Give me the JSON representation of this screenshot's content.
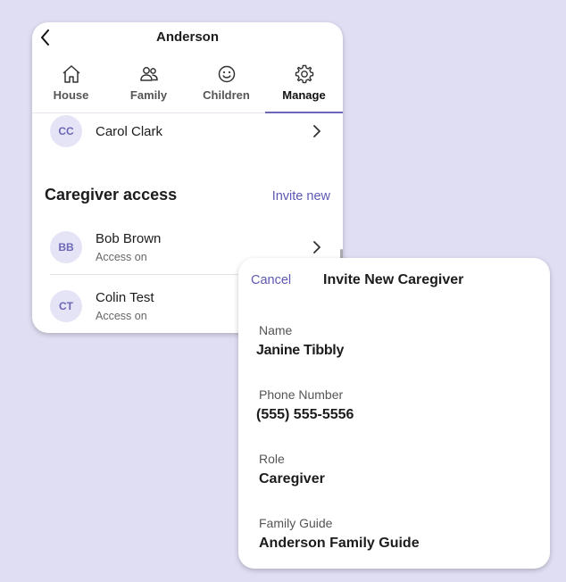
{
  "main": {
    "title": "Anderson",
    "tabs": [
      {
        "label": "House",
        "icon": "house-icon"
      },
      {
        "label": "Family",
        "icon": "family-icon"
      },
      {
        "label": "Children",
        "icon": "smiley-icon"
      },
      {
        "label": "Manage",
        "icon": "gear-icon",
        "active": true
      }
    ],
    "members": [
      {
        "initials": "CC",
        "name": "Carol Clark"
      }
    ],
    "caregiver_section": {
      "title": "Caregiver access",
      "invite_label": "Invite new"
    },
    "caregivers": [
      {
        "initials": "BB",
        "name": "Bob Brown",
        "status": "Access on"
      },
      {
        "initials": "CT",
        "name": "Colin Test",
        "status": "Access on"
      }
    ]
  },
  "sheet": {
    "cancel_label": "Cancel",
    "title": "Invite New Caregiver",
    "fields": [
      {
        "label": "Name",
        "value": "Janine Tibbly"
      },
      {
        "label": "Phone Number",
        "value": "(555) 555-5556"
      },
      {
        "label": "Role",
        "value": "Caregiver"
      },
      {
        "label": "Family Guide",
        "value": "Anderson Family Guide"
      }
    ]
  },
  "colors": {
    "background": "#dfdef3",
    "accent": "#5d58b3",
    "avatar_bg": "#e5e4f6"
  }
}
